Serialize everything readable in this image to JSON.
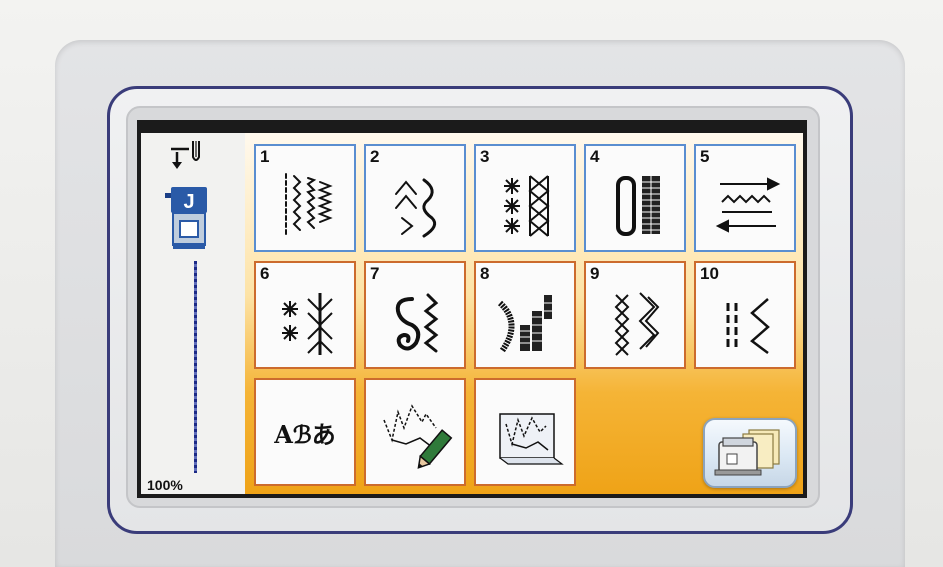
{
  "sidebar": {
    "zoom_label": "100%"
  },
  "stitch_categories": [
    {
      "number": "1",
      "icon": "utility-stitch-icon"
    },
    {
      "number": "2",
      "icon": "decorative-stitch-icon"
    },
    {
      "number": "3",
      "icon": "satin-cross-stitch-icon"
    },
    {
      "number": "4",
      "icon": "buttonhole-stitch-icon"
    },
    {
      "number": "5",
      "icon": "sideways-stitch-icon"
    },
    {
      "number": "6",
      "icon": "star-cross-stitch-icon"
    },
    {
      "number": "7",
      "icon": "scroll-stitch-icon"
    },
    {
      "number": "8",
      "icon": "satin-curve-stitch-icon"
    },
    {
      "number": "9",
      "icon": "cross-stitch-icon"
    },
    {
      "number": "10",
      "icon": "zigzag-stitch-icon"
    }
  ],
  "function_buttons": [
    {
      "icon": "character-stitch-icon",
      "label": "Aℬあ"
    },
    {
      "icon": "my-custom-stitch-icon"
    },
    {
      "icon": "saved-custom-stitch-icon"
    },
    {
      "icon": "machine-memory-icon"
    },
    {
      "icon": "usb-icon"
    }
  ],
  "colors": {
    "blue_border": "#5a8ed0",
    "orange_border": "#cc6b2d",
    "bezel": "#3a3c7a",
    "background_gradient_end": "#efa317"
  }
}
